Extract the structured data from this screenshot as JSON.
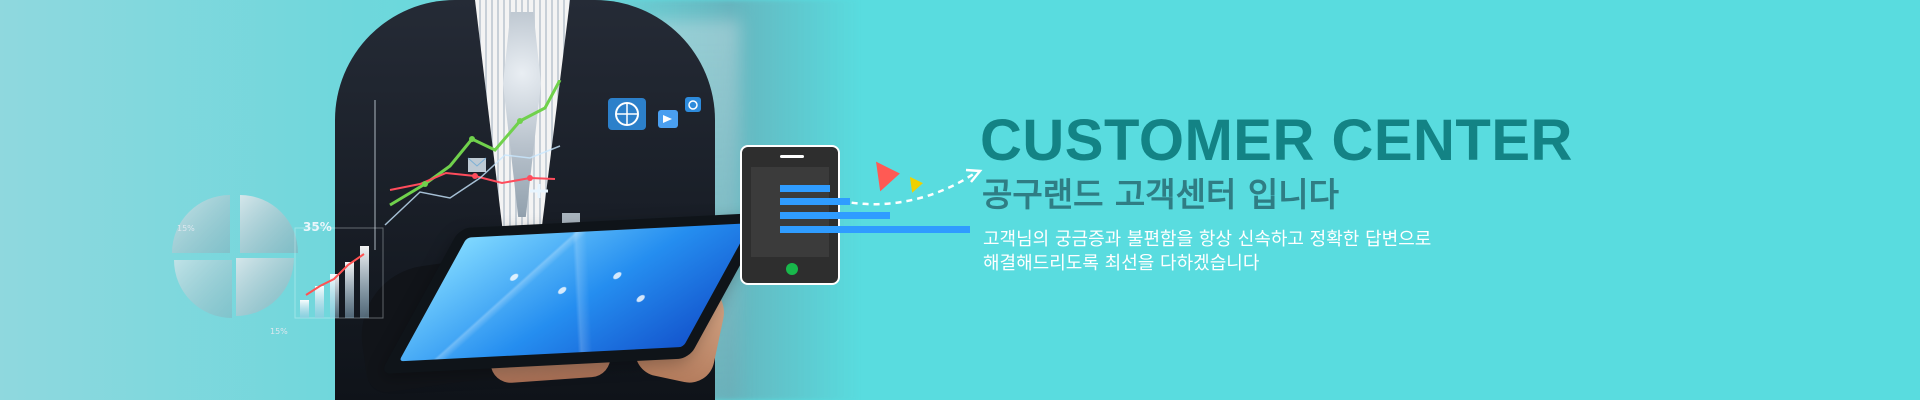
{
  "hero": {
    "title": "CUSTOMER CENTER",
    "subtitle": "공구랜드 고객센터 입니다",
    "description_lines": [
      "고객님의 궁금증과 불편함을 항상 신속하고 정확한 답변으로",
      "해결해드리도록 최선을 다하겠습니다"
    ]
  },
  "graphics": {
    "chart_label_1": "35%",
    "chart_label_2": "15%",
    "chart_label_3": "15%",
    "colors": {
      "background": "#59dcdf",
      "title": "#138385",
      "subtitle": "#2f7d84",
      "description": "#ffffff",
      "accent_red": "#ff5a54",
      "accent_yellow": "#f0d000",
      "accent_blue": "#2f9cff",
      "phone_button": "#18b84b"
    },
    "icons": [
      "globe-icon",
      "video-icon",
      "camera-icon",
      "envelope-icon",
      "airplane-icon",
      "phone-icon"
    ]
  }
}
